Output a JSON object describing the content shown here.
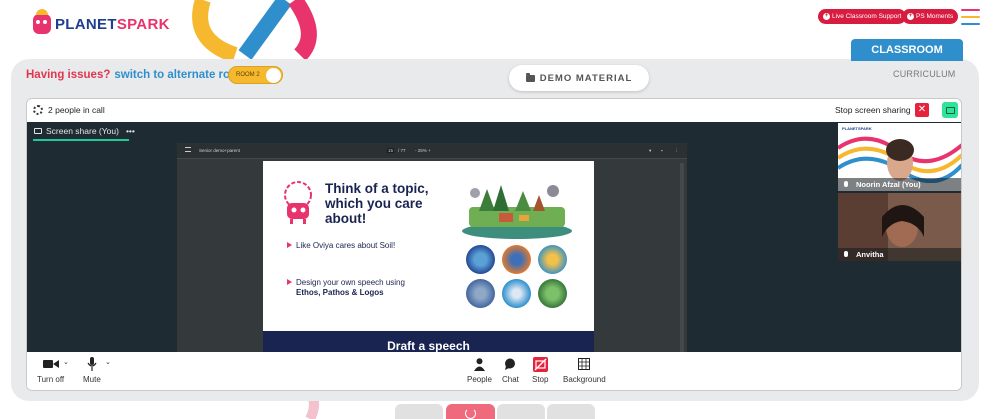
{
  "header": {
    "logo": {
      "part1": "PLANET",
      "part2": "SPARK"
    },
    "live_support": "Live Classroom Support",
    "ps_moments": "PS Moments"
  },
  "tabs": {
    "classroom": "CLASSROOM",
    "curriculum": "CURRICULUM"
  },
  "issues": {
    "text": "Having issues?",
    "link": "switch to alternate room",
    "room_label": "ROOM 2"
  },
  "demo_material": "DEMO MATERIAL",
  "call": {
    "people_count": "2 people in call",
    "stop_sharing": "Stop screen sharing",
    "screen_share_tab": "Screen share (You)",
    "tab_more": "•••"
  },
  "pdf_viewer": {
    "filename": "Senior demo+parent",
    "page": "15",
    "total": "/ 77",
    "zoom": "-  25%  +"
  },
  "slide": {
    "title": "Think of a topic, which you care about!",
    "bullet1": "Like Oviya cares about Soil!",
    "bullet2": "Design your own speech using",
    "bullet2_bold": "Ethos, Pathos & Logos",
    "footer": "Draft a speech",
    "mini_logo": "PLANETSPARK"
  },
  "participants": [
    {
      "name": "Noorin Afzal (You)"
    },
    {
      "name": "Anvitha"
    }
  ],
  "controls": {
    "turn_off": "Turn off",
    "mute": "Mute",
    "people": "People",
    "chat": "Chat",
    "stop": "Stop",
    "background": "Background"
  },
  "colors": {
    "brand_red": "#d81c3f",
    "brand_blue": "#2f8fcc",
    "brand_navy": "#1a2450",
    "accent_green": "#1ec99a",
    "accent_yellow": "#f5b82e"
  }
}
